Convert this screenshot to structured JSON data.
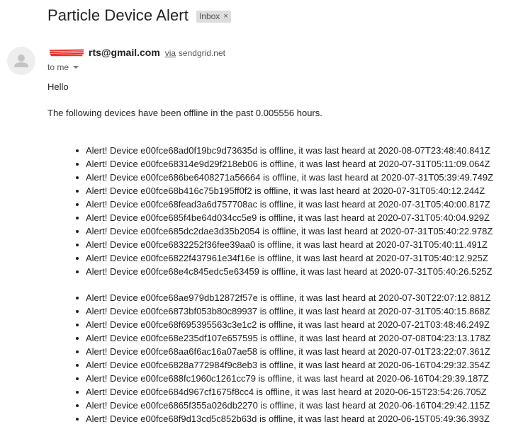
{
  "email": {
    "subject": "Particle Device Alert",
    "label": "Inbox",
    "label_close": "×",
    "sender_email": "rts@gmail.com",
    "via_text": "via",
    "via_domain": "sendgrid.net",
    "to_text": "to me",
    "greeting": "Hello",
    "intro": "The following devices have been offline in the past 0.005556 hours."
  },
  "alerts_group1": [
    "Alert! Device e00fce68ad0f19bc9d73635d is offline, it was last heard at 2020-08-07T23:48:40.841Z",
    "Alert! Device e00fce68314e9d29f218eb06 is offline, it was last heard at 2020-07-31T05:11:09.064Z",
    "Alert! Device e00fce686be6408271a56664 is offline, it was last heard at 2020-07-31T05:39:49.749Z",
    "Alert! Device e00fce68b416c75b195ff0f2 is offline, it was last heard at 2020-07-31T05:40:12.244Z",
    "Alert! Device e00fce68fead3a6d757708ac is offline, it was last heard at 2020-07-31T05:40:00.817Z",
    "Alert! Device e00fce685f4be64d034cc5e9 is offline, it was last heard at 2020-07-31T05:40:04.929Z",
    "Alert! Device e00fce685dc2dae3d35b2054 is offline, it was last heard at 2020-07-31T05:40:22.978Z",
    "Alert! Device e00fce6832252f36fee39aa0 is offline, it was last heard at 2020-07-31T05:40:11.491Z",
    "Alert! Device e00fce6822f437961e34f16e is offline, it was last heard at 2020-07-31T05:40:12.925Z",
    "Alert! Device e00fce68e4c845edc5e63459 is offline, it was last heard at 2020-07-31T05:40:26.525Z"
  ],
  "alerts_group2": [
    "Alert! Device e00fce68ae979db12872f57e is offline, it was last heard at 2020-07-30T22:07:12.881Z",
    "Alert! Device e00fce6873bf053b80c89937 is offline, it was last heard at 2020-07-31T05:40:15.868Z",
    "Alert! Device e00fce68f695395563c3e1c2 is offline, it was last heard at 2020-07-21T03:48:46.249Z",
    "Alert! Device e00fce68e235df107e657595 is offline, it was last heard at 2020-07-08T04:23:13.178Z",
    "Alert! Device e00fce68aa6f6ac16a07ae58 is offline, it was last heard at 2020-07-01T23:22:07.361Z",
    "Alert! Device e00fce6828a772984f9c8eb3 is offline, it was last heard at 2020-06-16T04:29:32.354Z",
    "Alert! Device e00fce688fc1960c1261cc79 is offline, it was last heard at 2020-06-16T04:29:39.187Z",
    "Alert! Device e00fce684d967cf1675f8cc4 is offline, it was last heard at 2020-06-15T23:54:26.705Z",
    "Alert! Device e00fce6865f355a026db2270 is offline, it was last heard at 2020-06-16T04:29:42.115Z",
    "Alert! Device e00fce68f9d13cd5c852b63d is offline, it was last heard at 2020-06-15T05:49:36.393Z"
  ]
}
